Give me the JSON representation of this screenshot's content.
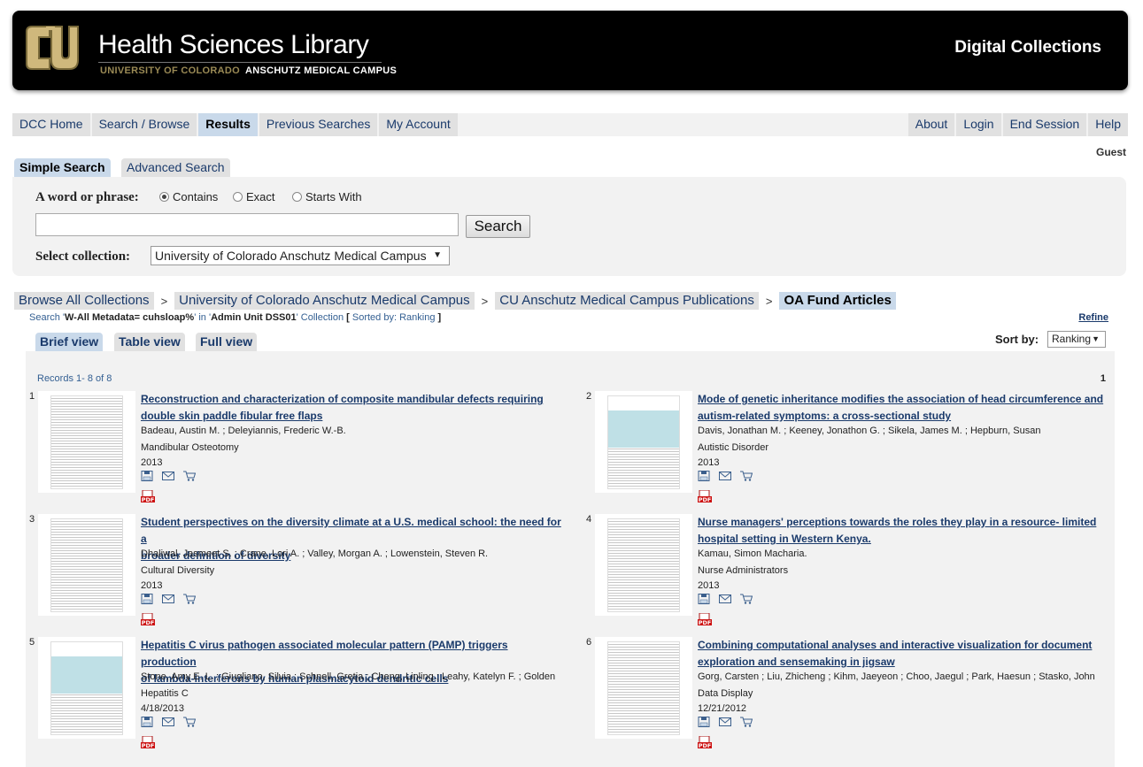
{
  "header": {
    "library_title": "Health Sciences Library",
    "university": "UNIVERSITY OF COLORADO",
    "campus": "ANSCHUTZ MEDICAL CAMPUS",
    "site_title": "Digital Collections"
  },
  "nav": {
    "left": [
      "DCC Home",
      "Search / Browse",
      "Results",
      "Previous Searches",
      "My Account"
    ],
    "right": [
      "About",
      "Login",
      "End Session",
      "Help"
    ],
    "active": "Results"
  },
  "user": {
    "status": "Guest"
  },
  "search": {
    "tabs": {
      "simple": "Simple Search",
      "advanced": "Advanced Search"
    },
    "phrase_label": "A word or phrase:",
    "options": [
      "Contains",
      "Exact",
      "Starts With"
    ],
    "selected_option": "Contains",
    "input_value": "",
    "button_label": "Search",
    "collection_label": "Select collection:",
    "collection_value": "University of Colorado Anschutz Medical Campus"
  },
  "breadcrumb": [
    "Browse All Collections",
    "University of Colorado Anschutz Medical Campus",
    "CU Anschutz Medical Campus Publications",
    "OA Fund Articles"
  ],
  "breadcrumb_separator": ">",
  "search_info": {
    "p1": "Search '",
    "query": "W-All Metadata= cuhsloap%",
    "p2": "' in '",
    "unit": "Admin Unit DSS01",
    "p3": "' Collection ",
    "b1": "[",
    "sorted": " Sorted by: Ranking ",
    "b2": "]"
  },
  "refine_label": "Refine",
  "views": {
    "brief": "Brief view",
    "table": "Table view",
    "full": "Full view",
    "active": "Brief view"
  },
  "sort": {
    "label": "Sort by:",
    "value": "Ranking"
  },
  "records_label": "Records 1- 8 of 8",
  "page_number": "1",
  "results": [
    {
      "num": "1",
      "title_l1": "Reconstruction and characterization of composite mandibular defects requiring",
      "title_l2": "double skin paddle fibular free flaps",
      "authors": "Badeau, Austin M. ; Deleyiannis, Frederic W.-B.",
      "subject": "Mandibular Osteotomy",
      "date": "2013"
    },
    {
      "num": "2",
      "title_l1": "Mode of genetic inheritance modifies the association of head circumference and",
      "title_l2": "autism-related symptoms: a cross-sectional study",
      "authors": "Davis, Jonathan M. ; Keeney, Jonathon G. ; Sikela, James M. ; Hepburn, Susan",
      "subject": "Autistic Disorder",
      "date": "2013"
    },
    {
      "num": "3",
      "title_l1": "Student perspectives on the diversity climate at a U.S. medical school: the need for a",
      "title_l2": "broader definition of diversity",
      "authors": "Dhaliwal, Jasmeet S. ; Crane, Lori A. ; Valley, Morgan A. ; Lowenstein, Steven R.",
      "subject": "Cultural Diversity",
      "date": "2013"
    },
    {
      "num": "4",
      "title_l1": "Nurse managers' perceptions towards the roles they play in a resource- limited",
      "title_l2": "hospital setting in Western Kenya.",
      "authors": "Kamau, Simon Macharia.",
      "subject": "Nurse Administrators",
      "date": "2013"
    },
    {
      "num": "5",
      "title_l1": "Hepatitis C virus pathogen associated molecular pattern (PAMP) triggers production",
      "title_l2": "of lambda-interferons by human plasmacytoid dendritic cells",
      "authors": "Stone, Amy E. L. ; Giugliano, Silvia ; Schnell, Gretja ; Cheng, Linling ; Leahy, Katelyn F. ; Golden",
      "subject": "Hepatitis C",
      "date": "4/18/2013"
    },
    {
      "num": "6",
      "title_l1": "Combining computational analyses and interactive visualization for document",
      "title_l2": "exploration and sensemaking in jigsaw",
      "authors": "Gorg, Carsten ; Liu, Zhicheng ; Kihm, Jaeyeon ; Choo, Jaegul ; Park, Haesun ; Stasko, John",
      "subject": "Data Display",
      "date": "12/21/2012"
    }
  ],
  "colors": {
    "link": "#1a3a6b",
    "active_tab": "#c9d9ea",
    "inactive_tab": "#e1e1e1",
    "panel": "#f2f2f2",
    "header_bg": "#000000",
    "gold": "#cfb87c"
  },
  "icons": [
    "cu-logo-icon",
    "save-icon",
    "email-icon",
    "cart-icon",
    "pdf-icon",
    "chevron-down-icon"
  ]
}
